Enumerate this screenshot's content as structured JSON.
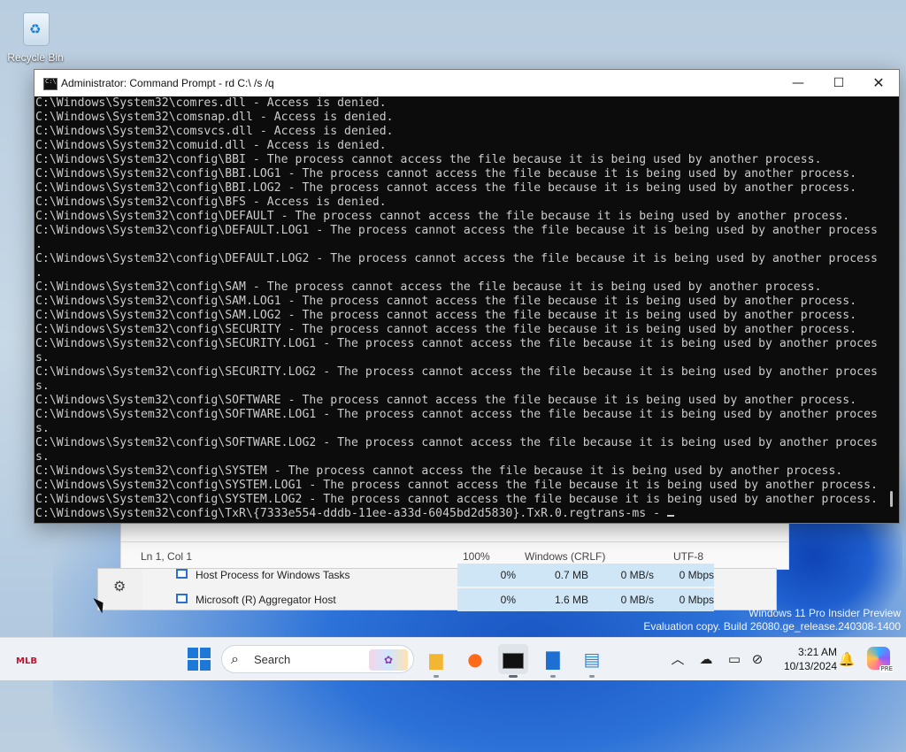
{
  "desktop": {
    "recycle_bin_label": "Recycle Bin",
    "watermark_line1": "Windows 11 Pro Insider Preview",
    "watermark_line2": "Evaluation copy. Build 26080.ge_release.240308-1400"
  },
  "cmd": {
    "title": "Administrator: Command Prompt - rd  C:\\ /s /q",
    "lines": [
      "C:\\Windows\\System32\\comres.dll - Access is denied.",
      "C:\\Windows\\System32\\comsnap.dll - Access is denied.",
      "C:\\Windows\\System32\\comsvcs.dll - Access is denied.",
      "C:\\Windows\\System32\\comuid.dll - Access is denied.",
      "C:\\Windows\\System32\\config\\BBI - The process cannot access the file because it is being used by another process.",
      "C:\\Windows\\System32\\config\\BBI.LOG1 - The process cannot access the file because it is being used by another process.",
      "C:\\Windows\\System32\\config\\BBI.LOG2 - The process cannot access the file because it is being used by another process.",
      "C:\\Windows\\System32\\config\\BFS - Access is denied.",
      "C:\\Windows\\System32\\config\\DEFAULT - The process cannot access the file because it is being used by another process.",
      "C:\\Windows\\System32\\config\\DEFAULT.LOG1 - The process cannot access the file because it is being used by another process",
      ".",
      "C:\\Windows\\System32\\config\\DEFAULT.LOG2 - The process cannot access the file because it is being used by another process",
      ".",
      "C:\\Windows\\System32\\config\\SAM - The process cannot access the file because it is being used by another process.",
      "C:\\Windows\\System32\\config\\SAM.LOG1 - The process cannot access the file because it is being used by another process.",
      "C:\\Windows\\System32\\config\\SAM.LOG2 - The process cannot access the file because it is being used by another process.",
      "C:\\Windows\\System32\\config\\SECURITY - The process cannot access the file because it is being used by another process.",
      "C:\\Windows\\System32\\config\\SECURITY.LOG1 - The process cannot access the file because it is being used by another proces",
      "s.",
      "C:\\Windows\\System32\\config\\SECURITY.LOG2 - The process cannot access the file because it is being used by another proces",
      "s.",
      "C:\\Windows\\System32\\config\\SOFTWARE - The process cannot access the file because it is being used by another process.",
      "C:\\Windows\\System32\\config\\SOFTWARE.LOG1 - The process cannot access the file because it is being used by another proces",
      "s.",
      "C:\\Windows\\System32\\config\\SOFTWARE.LOG2 - The process cannot access the file because it is being used by another proces",
      "s.",
      "C:\\Windows\\System32\\config\\SYSTEM - The process cannot access the file because it is being used by another process.",
      "C:\\Windows\\System32\\config\\SYSTEM.LOG1 - The process cannot access the file because it is being used by another process.",
      "C:\\Windows\\System32\\config\\SYSTEM.LOG2 - The process cannot access the file because it is being used by another process.",
      "C:\\Windows\\System32\\config\\TxR\\{7333e554-dddb-11ee-a33d-6045bd2d5830}.TxR.0.regtrans-ms - "
    ]
  },
  "notepad_status": {
    "position": "Ln 1, Col 1",
    "zoom": "100%",
    "line_ending": "Windows (CRLF)",
    "encoding": "UTF-8"
  },
  "task_manager": {
    "rows": [
      {
        "name": "Host Process for Windows Tasks",
        "cpu": "0%",
        "memory": "0.7 MB",
        "disk": "0 MB/s",
        "network": "0 Mbps"
      },
      {
        "name": "Microsoft (R) Aggregator Host",
        "cpu": "0%",
        "memory": "1.6 MB",
        "disk": "0 MB/s",
        "network": "0 Mbps"
      }
    ]
  },
  "taskbar": {
    "widgets_label": "MLB",
    "search_placeholder": "Search",
    "time": "3:21 AM",
    "date": "10/13/2024",
    "copilot_badge": "PRE"
  }
}
